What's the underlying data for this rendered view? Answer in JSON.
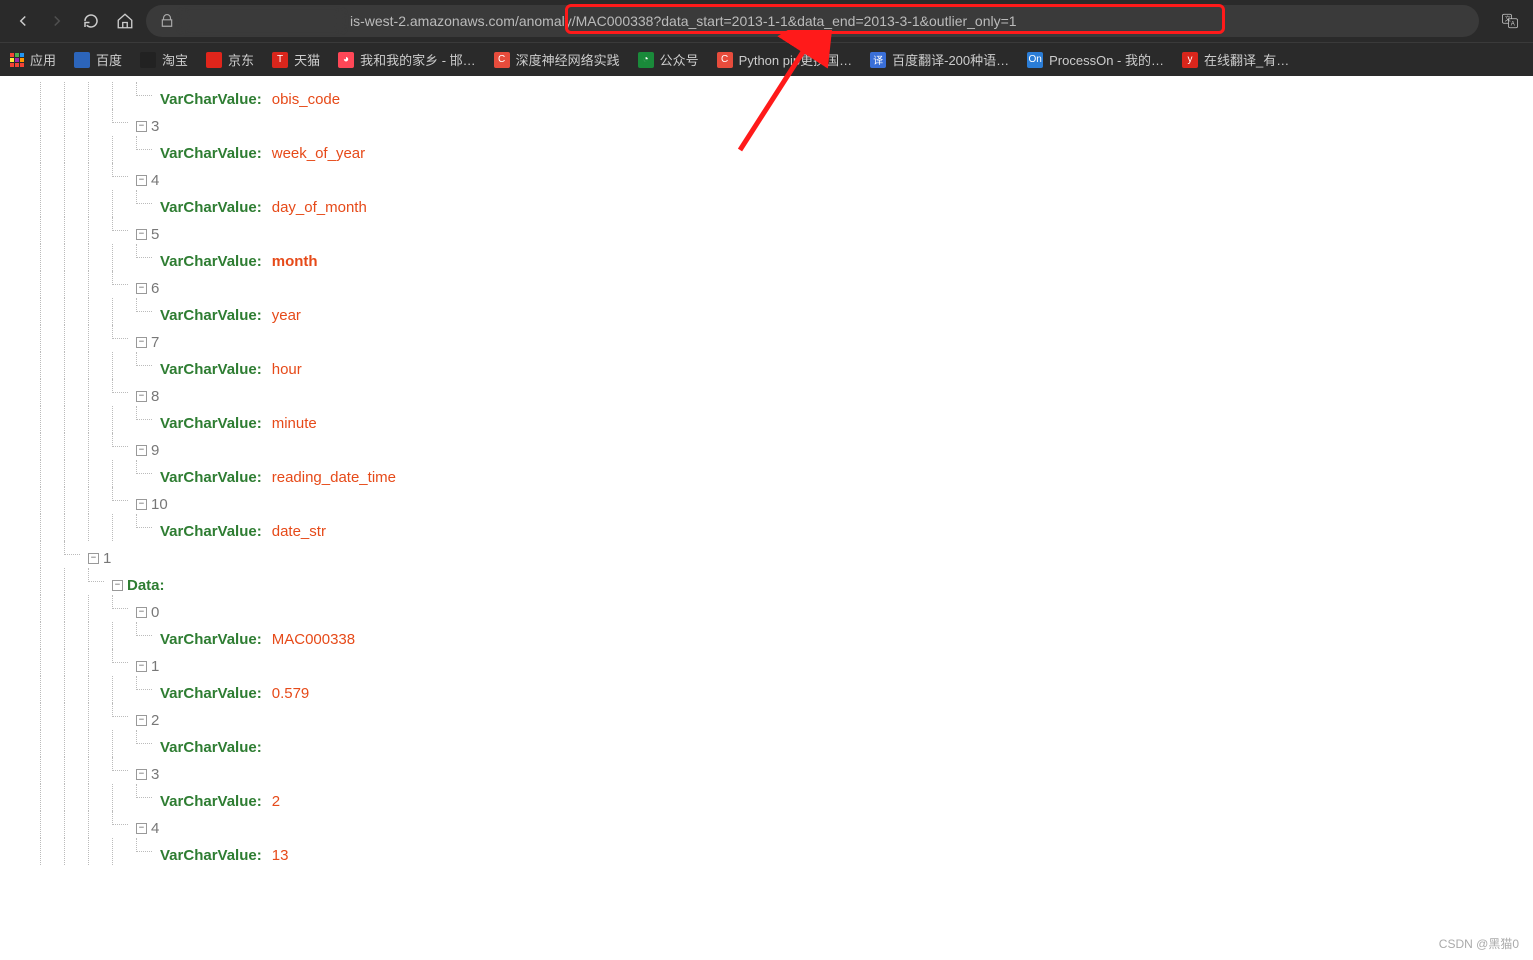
{
  "url": {
    "visible_suffix": "is-west-2.amazonaws.com/anomaly/MAC000338?data_start=2013-1-1&data_end=2013-3-1&outlier_only=1"
  },
  "bookmarks": [
    {
      "label": "应用",
      "icon_type": "apps"
    },
    {
      "label": "百度",
      "icon_bg": "#2c65bb",
      "icon_char": ""
    },
    {
      "label": "淘宝",
      "icon_bg": "#222",
      "icon_char": ""
    },
    {
      "label": "京东",
      "icon_bg": "#e1251b",
      "icon_char": ""
    },
    {
      "label": "天猫",
      "icon_bg": "#d9261c",
      "icon_char": "T"
    },
    {
      "label": "我和我的家乡 - 邯…",
      "icon_bg": "#ff4757",
      "icon_char": "◕"
    },
    {
      "label": "深度神经网络实践",
      "icon_bg": "#e74c3c",
      "icon_char": "C"
    },
    {
      "label": "公众号",
      "icon_bg": "#1a8a3a",
      "icon_char": "◔"
    },
    {
      "label": "Python pip更换国…",
      "icon_bg": "#e74c3c",
      "icon_char": "C"
    },
    {
      "label": "百度翻译-200种语…",
      "icon_bg": "#3a6fd8",
      "icon_char": "译"
    },
    {
      "label": "ProcessOn - 我的…",
      "icon_bg": "#2b7dd6",
      "icon_char": "On"
    },
    {
      "label": "在线翻译_有…",
      "icon_bg": "#d9261c",
      "icon_char": "y"
    }
  ],
  "tree": {
    "header_key": "VarCharValue",
    "data_label": "Data",
    "headers": [
      {
        "idx": "",
        "val": "obis_code"
      },
      {
        "idx": "3",
        "val": "week_of_year"
      },
      {
        "idx": "4",
        "val": "day_of_month"
      },
      {
        "idx": "5",
        "val": "month",
        "bold": true
      },
      {
        "idx": "6",
        "val": "year"
      },
      {
        "idx": "7",
        "val": "hour"
      },
      {
        "idx": "8",
        "val": "minute"
      },
      {
        "idx": "9",
        "val": "reading_date_time"
      },
      {
        "idx": "10",
        "val": "date_str"
      }
    ],
    "outer_idx": "1",
    "data_rows": [
      {
        "idx": "0",
        "val": "MAC000338"
      },
      {
        "idx": "1",
        "val": "0.579"
      },
      {
        "idx": "2",
        "val": ""
      },
      {
        "idx": "3",
        "val": "2"
      },
      {
        "idx": "4",
        "val": "13"
      }
    ]
  },
  "watermark": "CSDN @黑猫0"
}
